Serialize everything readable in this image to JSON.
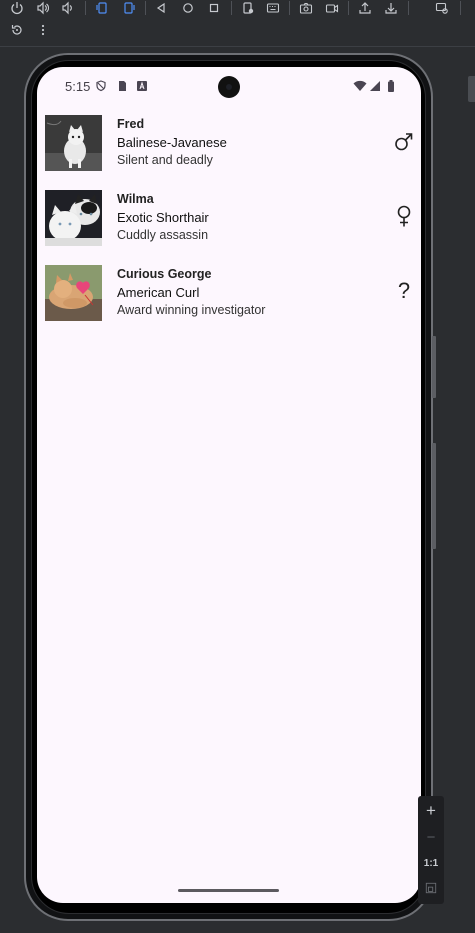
{
  "toolbar": {
    "row1_icons": [
      "power-icon",
      "volume-up-icon",
      "volume-down-icon",
      "rotate-left-icon",
      "rotate-right-icon",
      "back-icon",
      "home-icon",
      "overview-icon",
      "fold-icon",
      "keyboard-icon",
      "camera-icon",
      "record-icon",
      "upload-icon",
      "download-icon",
      "window-icon"
    ],
    "row2_icons": [
      "undo-icon",
      "more-icon"
    ]
  },
  "status_bar": {
    "time": "5:15"
  },
  "cats": [
    {
      "name": "Fred",
      "breed": "Balinese-Javanese",
      "description": "Silent and deadly",
      "gender_icon": "male-icon"
    },
    {
      "name": "Wilma",
      "breed": "Exotic Shorthair",
      "description": "Cuddly assassin",
      "gender_icon": "female-icon"
    },
    {
      "name": "Curious George",
      "breed": "American Curl",
      "description": "Award winning investigator",
      "gender_icon": "unknown-gender-icon",
      "gender_glyph": "?"
    }
  ],
  "zoom": {
    "plus": "+",
    "minus": "−",
    "one_to_one": "1:1"
  },
  "colors": {
    "screen_bg": "#fdf7fe",
    "chrome_bg": "#2b2d30"
  }
}
